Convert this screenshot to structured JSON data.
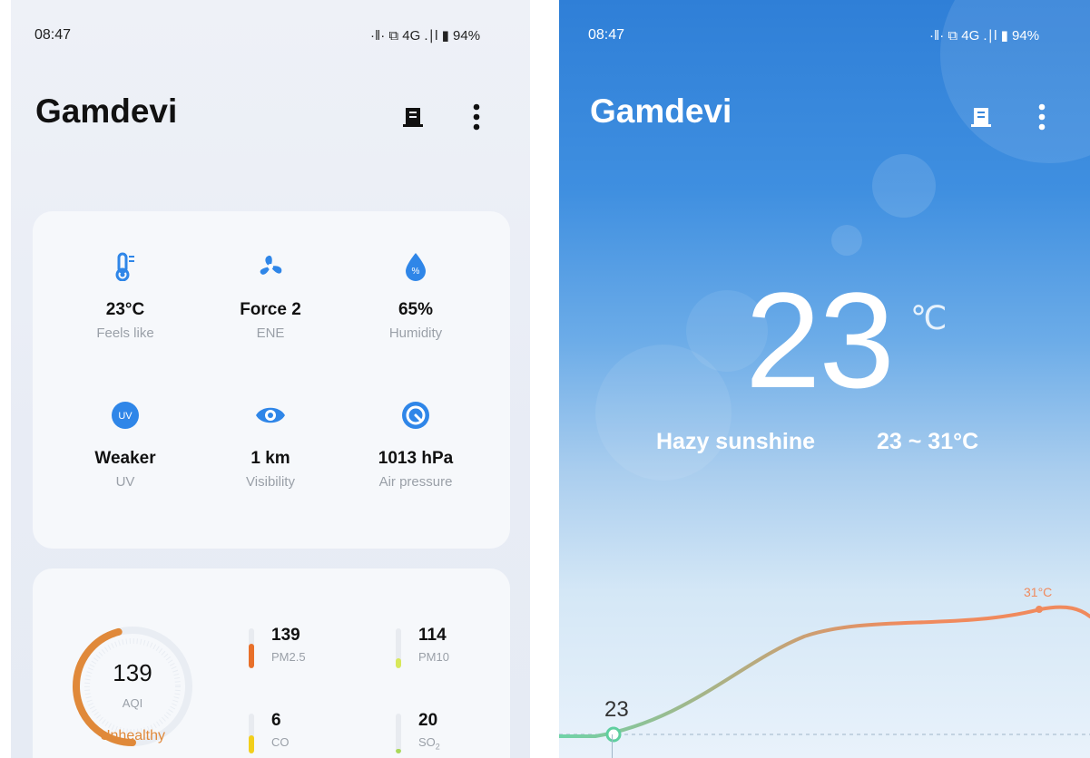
{
  "left_screen": {
    "status_bar": {
      "time": "08:47",
      "indicators": "·‖· ⧉ 4G .∣l ▮",
      "battery": "94%"
    },
    "title": "Gamdevi",
    "toolbar_icons": [
      "building-icon",
      "more-vert-icon"
    ],
    "details": [
      {
        "icon": "thermometer-icon",
        "value": "23°C",
        "label": "Feels like"
      },
      {
        "icon": "fan-icon",
        "value": "Force 2",
        "label": "ENE"
      },
      {
        "icon": "humidity-drop-icon",
        "value": "65%",
        "label": "Humidity"
      },
      {
        "icon": "uv-icon",
        "icon_text": "UV",
        "value": "Weaker",
        "label": "UV"
      },
      {
        "icon": "eye-icon",
        "value": "1 km",
        "label": "Visibility"
      },
      {
        "icon": "gauge-icon",
        "value": "1013 hPa",
        "label": "Air pressure"
      }
    ],
    "aqi": {
      "value": "139",
      "label": "AQI",
      "status": "Unhealthy",
      "gauge_fraction": 0.46,
      "color": "#e0893a",
      "pollutants": [
        {
          "value": "139",
          "label": "PM2.5",
          "level": 0.62,
          "color": "#e8702a"
        },
        {
          "value": "114",
          "label": "PM10",
          "level": 0.25,
          "color": "#d8e85a"
        },
        {
          "value": "6",
          "label": "CO",
          "level": 0.45,
          "color": "#f2cf1c"
        },
        {
          "value": "20",
          "label": "SO",
          "label_sub": "2",
          "level": 0.12,
          "color": "#a9d85a"
        }
      ]
    }
  },
  "right_screen": {
    "status_bar": {
      "time": "08:47",
      "indicators": "·‖· ⧉ 4G .∣l ▮",
      "battery": "94%"
    },
    "title": "Gamdevi",
    "toolbar_icons": [
      "building-icon",
      "more-vert-icon"
    ],
    "current_temp": "23",
    "unit": "℃",
    "condition": "Hazy sunshine",
    "range": "23 ~ 31°C",
    "hourly_chart": {
      "start_label": "23",
      "max_label": "31°C",
      "colors": {
        "cool": "#6fd3a8",
        "warm": "#f08a5d"
      }
    }
  }
}
